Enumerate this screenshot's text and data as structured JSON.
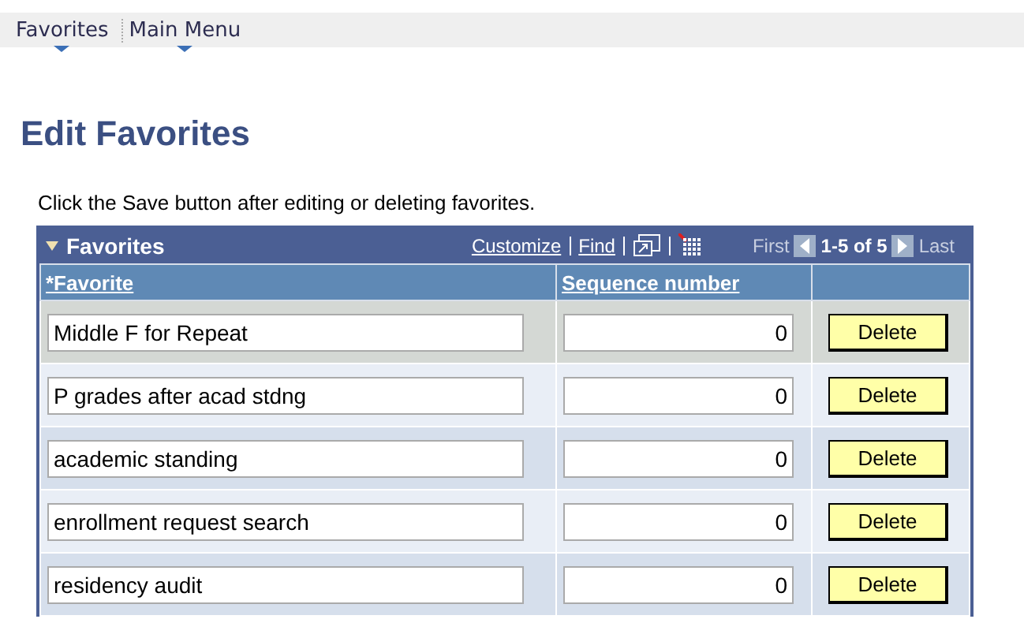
{
  "menu_bar": [
    {
      "label": "Favorites"
    },
    {
      "label": "Main Menu"
    }
  ],
  "page_title": "Edit Favorites",
  "instruction": "Click the Save button after editing or deleting favorites.",
  "grid": {
    "title": "Favorites",
    "expanded": true,
    "links": [
      "Customize",
      "Find"
    ],
    "nav": {
      "first": "First",
      "range": "1-5 of 5",
      "last": "Last"
    },
    "columns": [
      "*Favorite",
      "Sequence number"
    ],
    "rows": [
      {
        "favorite": "Middle F for Repeat",
        "sequence": "0",
        "button": "Delete",
        "selected": true
      },
      {
        "favorite": "P grades after acad stdng",
        "sequence": "0",
        "button": "Delete",
        "selected": false
      },
      {
        "favorite": "academic standing",
        "sequence": "0",
        "button": "Delete",
        "selected": false
      },
      {
        "favorite": "enrollment request search",
        "sequence": "0",
        "button": "Delete",
        "selected": false
      },
      {
        "favorite": "residency audit",
        "sequence": "0",
        "button": "Delete",
        "selected": false
      }
    ]
  }
}
